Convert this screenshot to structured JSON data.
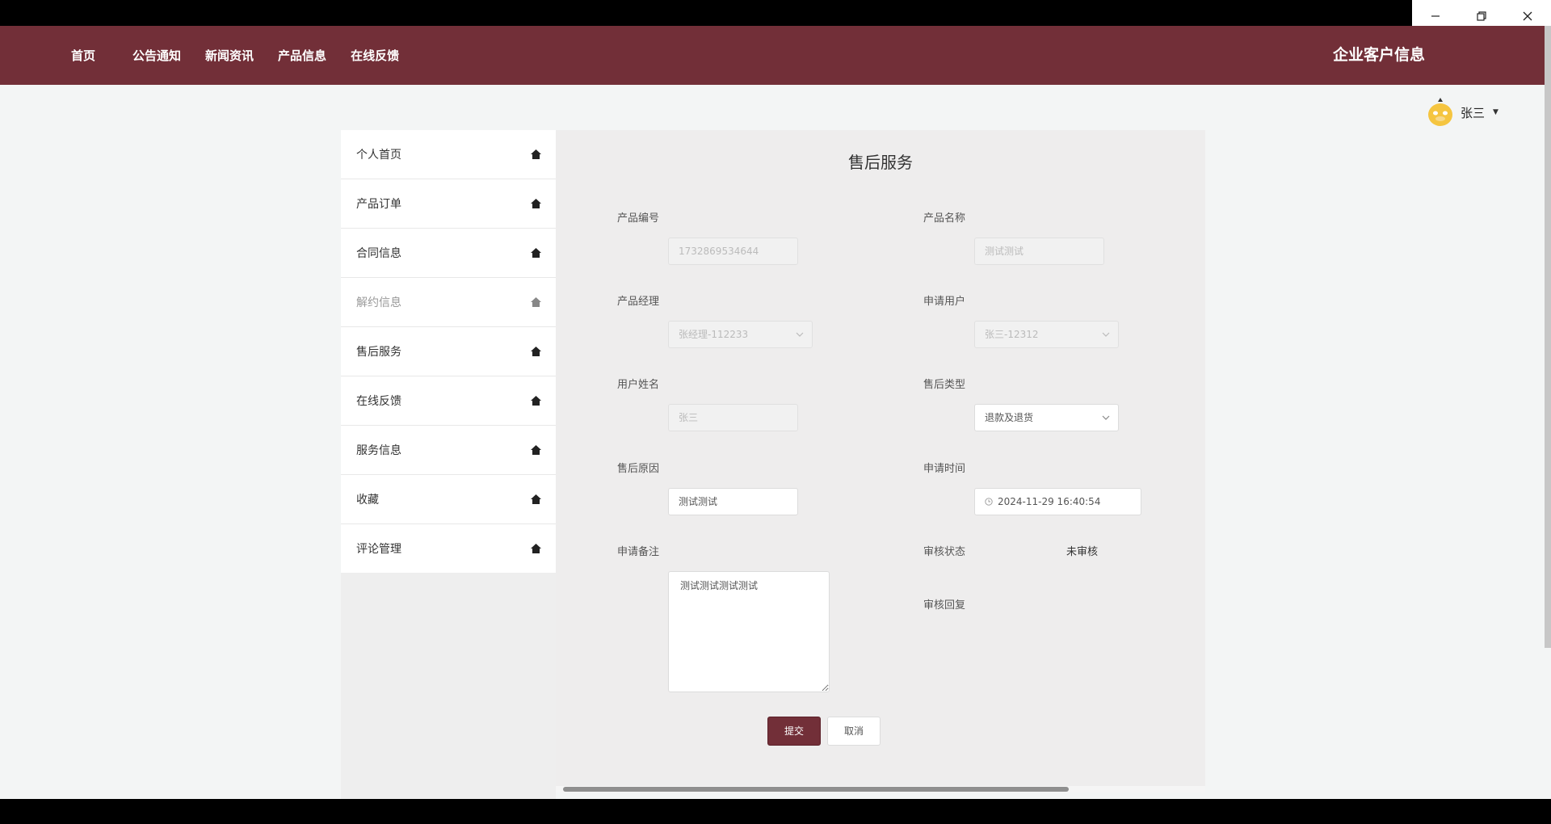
{
  "window": {
    "controls": [
      "minimize-icon",
      "restore-icon",
      "close-icon"
    ]
  },
  "nav": {
    "items": [
      "首页",
      "公告通知",
      "新闻资讯",
      "产品信息",
      "在线反馈"
    ],
    "brand": "企业客户信息"
  },
  "user": {
    "name": "张三"
  },
  "sidebar": {
    "items": [
      {
        "label": "个人首页"
      },
      {
        "label": "产品订单"
      },
      {
        "label": "合同信息"
      },
      {
        "label": "解约信息"
      },
      {
        "label": "售后服务"
      },
      {
        "label": "在线反馈"
      },
      {
        "label": "服务信息"
      },
      {
        "label": "收藏"
      },
      {
        "label": "评论管理"
      }
    ],
    "icon": "home-icon"
  },
  "form": {
    "title": "售后服务",
    "fields": {
      "product_no": {
        "label": "产品编号",
        "value": "1732869534644"
      },
      "product_name": {
        "label": "产品名称",
        "value": "测试测试"
      },
      "product_manager": {
        "label": "产品经理",
        "value": "张经理-112233"
      },
      "apply_user": {
        "label": "申请用户",
        "value": "张三-12312"
      },
      "user_name": {
        "label": "用户姓名",
        "value": "张三"
      },
      "service_type": {
        "label": "售后类型",
        "value": "退款及退货"
      },
      "reason": {
        "label": "售后原因",
        "value": "测试测试"
      },
      "apply_time": {
        "label": "申请时间",
        "value": "2024-11-29 16:40:54"
      },
      "remark": {
        "label": "申请备注",
        "value": "测试测试测试测试"
      },
      "audit_status": {
        "label": "审核状态",
        "value": "未审核"
      },
      "audit_reply": {
        "label": "审核回复"
      }
    },
    "submit_label": "提交",
    "cancel_label": "取消"
  },
  "colors": {
    "brand": "#722f38",
    "background": "#f3f5f5",
    "panel": "#eeeded"
  }
}
